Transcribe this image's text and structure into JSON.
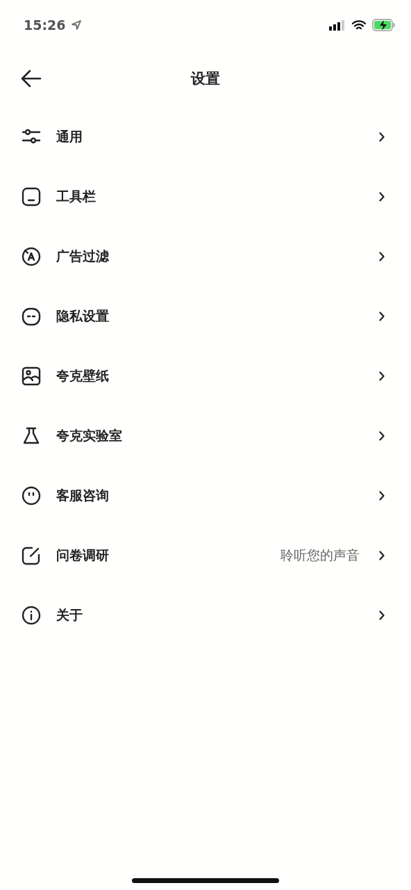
{
  "status_bar": {
    "time": "15:26"
  },
  "nav": {
    "title": "设置"
  },
  "items": [
    {
      "label": "通用"
    },
    {
      "label": "工具栏"
    },
    {
      "label": "广告过滤"
    },
    {
      "label": "隐私设置"
    },
    {
      "label": "夸克壁纸"
    },
    {
      "label": "夸克实验室"
    },
    {
      "label": "客服咨询"
    },
    {
      "label": "问卷调研",
      "hint": "聆听您的声音"
    },
    {
      "label": "关于"
    }
  ]
}
